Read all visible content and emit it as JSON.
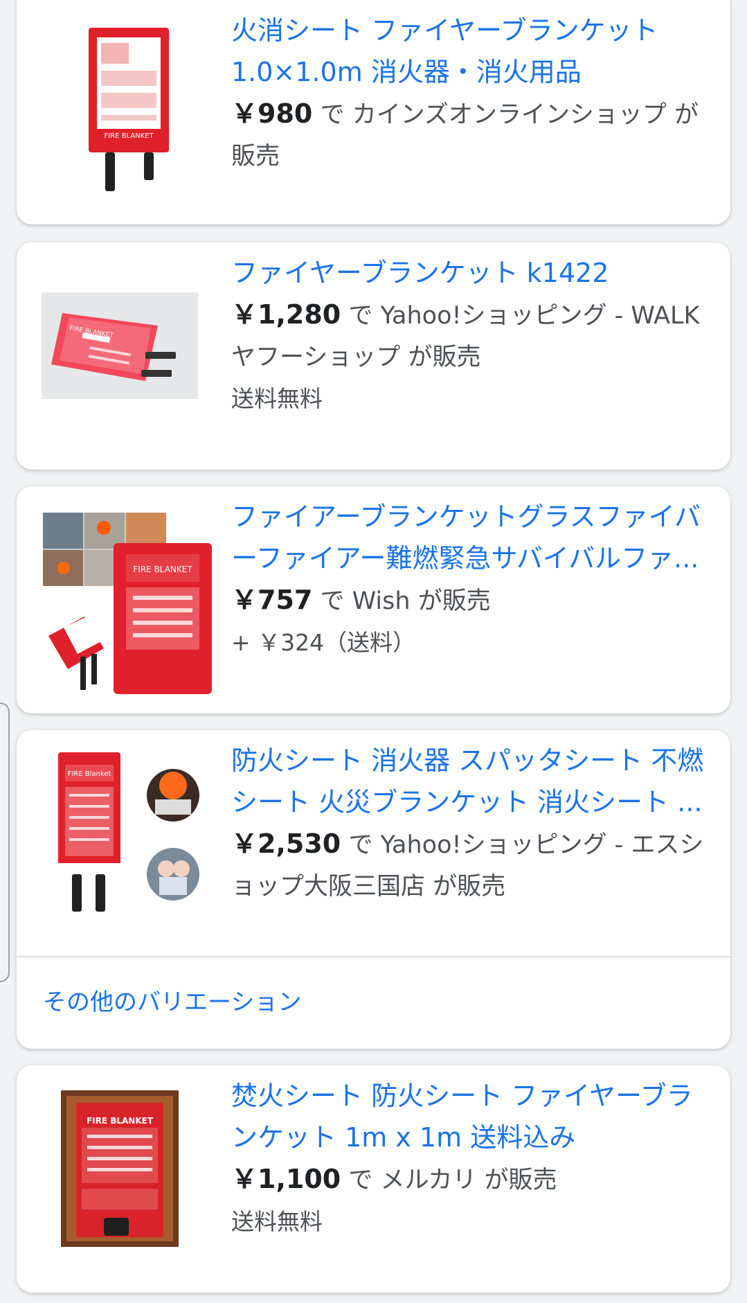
{
  "colors": {
    "link": "#1a73e8",
    "price": "#202124",
    "muted": "#4d5156",
    "product_red": "#e0202a"
  },
  "results": [
    {
      "title": "火消シート ファイヤーブランケット 1.0×1.0m 消火器・消火用品",
      "price": "￥980",
      "sep": " で ",
      "seller": "カインズオンラインショップ",
      "suffix": " が販売",
      "note": "",
      "image_label": "FIRE BLANKET"
    },
    {
      "title": "ファイヤーブランケット k1422",
      "price": "￥1,280",
      "sep": " で ",
      "seller": "Yahoo!ショッピング - WALKヤフーショップ",
      "suffix": " が販売",
      "note": "送料無料",
      "image_label": "FIRE BLANKET"
    },
    {
      "title": "ファイアーブランケットグラスファイバーファイアー難燃緊急サバイバルファ...",
      "price": "￥757",
      "sep": " で ",
      "seller": "Wish",
      "suffix": " が販売",
      "note": "+ ￥324（送料）",
      "image_label": "FIRE BLANKET"
    },
    {
      "title": "防火シート 消火器 スパッタシート 不燃シート 火災ブランケット 消火シート ...",
      "price": "￥2,530",
      "sep": " で ",
      "seller": "Yahoo!ショッピング - エスショップ大阪三国店",
      "suffix": " が販売",
      "note": "",
      "more_variations": "その他のバリエーション",
      "image_label": "FIRE Blanket"
    },
    {
      "title": "焚火シート 防火シート ファイヤーブランケット 1m x 1m 送料込み",
      "price": "￥1,100",
      "sep": " で ",
      "seller": "メルカリ",
      "suffix": " が販売",
      "note": "送料無料",
      "image_label": "FIRE BLANKET"
    }
  ]
}
